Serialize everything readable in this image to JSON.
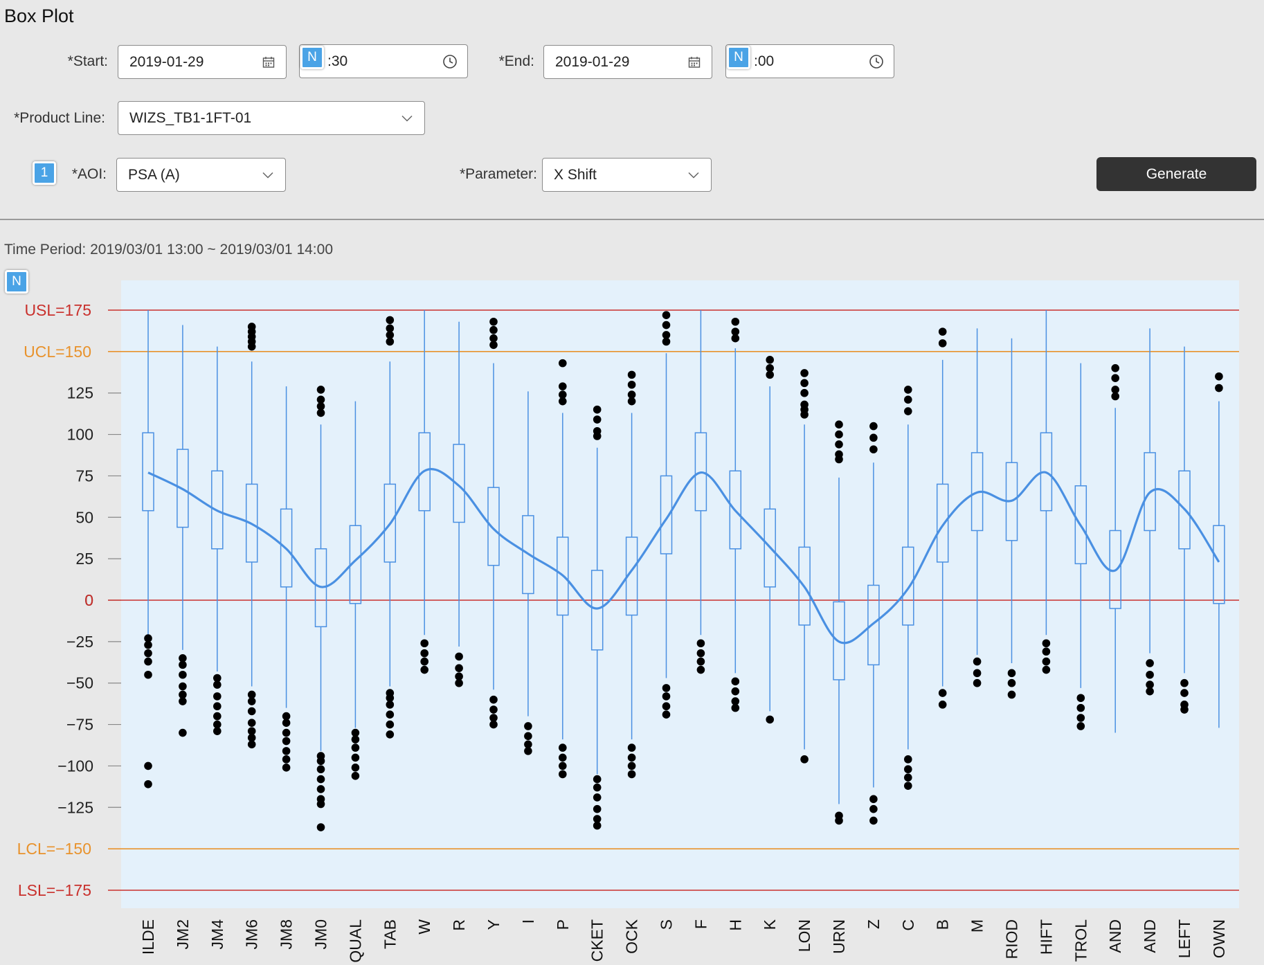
{
  "page": {
    "title": "Box Plot"
  },
  "filters": {
    "start_label": "*Start:",
    "start_date": "2019-01-29",
    "start_time": ":30",
    "end_label": "*End:",
    "end_date": "2019-01-29",
    "end_time": ":00",
    "product_line_label": "*Product Line:",
    "product_line_value": "WIZS_TB1-1FT-01",
    "aoi_label": "*AOI:",
    "aoi_value": "PSA (A)",
    "parameter_label": "*Parameter:",
    "parameter_value": "X Shift",
    "generate_label": "Generate"
  },
  "badges": {
    "start_time": "N",
    "end_time": "N",
    "aoi": "1",
    "chart": "N"
  },
  "time_period": "Time Period: 2019/03/01 13:00 ~ 2019/03/01 14:00",
  "icons": {
    "date": "calendar-icon",
    "time": "clock-icon",
    "select": "chevron-down-icon"
  },
  "colors": {
    "accent": "#4a90e2",
    "spec_limit": "#c9302c",
    "control_limit": "#e8922c",
    "zero_line": "#c9302c",
    "plot_bg": "#e4f1fb",
    "button": "#333333",
    "badge": "#4aa3e6"
  },
  "chart_data": {
    "type": "box",
    "ylim": [
      -185,
      185
    ],
    "yticks": [
      125,
      100,
      75,
      50,
      25,
      0,
      -25,
      -50,
      -75,
      -100,
      -125
    ],
    "ytick_labels": [
      "125",
      "100",
      "75",
      "50",
      "25",
      "0",
      "−25",
      "−50",
      "−75",
      "−100",
      "−125"
    ],
    "reference_lines": [
      {
        "label": "USL=175",
        "value": 175,
        "kind": "spec"
      },
      {
        "label": "UCL=150",
        "value": 150,
        "kind": "control"
      },
      {
        "label": "0",
        "value": 0,
        "kind": "zero"
      },
      {
        "label": "LCL=−150",
        "value": -150,
        "kind": "control"
      },
      {
        "label": "LSL=−175",
        "value": -175,
        "kind": "spec"
      }
    ],
    "categories": [
      "ILDE",
      "JM2",
      "JM4",
      "JM6",
      "JM8",
      "JM0",
      "QUAL",
      "TAB",
      "W",
      "R",
      "Y",
      "I",
      "P",
      "CKET",
      "OCK",
      "S",
      "F",
      "H",
      "K",
      "LON",
      "URN",
      "Z",
      "C",
      "B",
      "M",
      "RIOD",
      "HIFT",
      "TROL",
      "AND",
      "AND",
      "LEFT",
      "OWN"
    ],
    "boxes": [
      {
        "min": -22,
        "q1": 54,
        "q3": 101,
        "max": 175,
        "outliers": [
          -23,
          -27,
          -32,
          -37,
          -45,
          -100,
          -111
        ]
      },
      {
        "min": -30,
        "q1": 44,
        "q3": 91,
        "max": 166,
        "outliers": [
          -35,
          -39,
          -45,
          -52,
          -57,
          -61,
          -80
        ]
      },
      {
        "min": -43,
        "q1": 31,
        "q3": 78,
        "max": 153,
        "outliers": [
          -47,
          -51,
          -58,
          -64,
          -70,
          -75,
          -79
        ]
      },
      {
        "min": -52,
        "q1": 23,
        "q3": 70,
        "max": 144,
        "outliers": [
          -57,
          -61,
          -67,
          -74,
          -79,
          -83,
          -87,
          165,
          162,
          159,
          156,
          153
        ]
      },
      {
        "min": -65,
        "q1": 8,
        "q3": 55,
        "max": 129,
        "outliers": [
          -70,
          -74,
          -80,
          -85,
          -91,
          -96,
          -101
        ]
      },
      {
        "min": -91,
        "q1": -16,
        "q3": 31,
        "max": 106,
        "outliers": [
          -94,
          -97,
          -102,
          -108,
          -114,
          -120,
          -123,
          -137,
          127,
          121,
          117,
          113
        ]
      },
      {
        "min": -77,
        "q1": -2,
        "q3": 45,
        "max": 120,
        "outliers": [
          -80,
          -84,
          -89,
          -95,
          -101,
          -106
        ]
      },
      {
        "min": -52,
        "q1": 23,
        "q3": 70,
        "max": 144,
        "outliers": [
          -56,
          -59,
          -63,
          -69,
          -75,
          -81,
          169,
          164,
          160,
          156
        ]
      },
      {
        "min": -21,
        "q1": 54,
        "q3": 101,
        "max": 175,
        "outliers": [
          -26,
          -32,
          -37,
          -42
        ]
      },
      {
        "min": -28,
        "q1": 47,
        "q3": 94,
        "max": 168,
        "outliers": [
          -34,
          -41,
          -46,
          -50
        ]
      },
      {
        "min": -54,
        "q1": 21,
        "q3": 68,
        "max": 143,
        "outliers": [
          -60,
          -66,
          -71,
          -75,
          168,
          163,
          158,
          154
        ]
      },
      {
        "min": -70,
        "q1": 4,
        "q3": 51,
        "max": 126,
        "outliers": [
          -76,
          -82,
          -87,
          -91
        ]
      },
      {
        "min": -84,
        "q1": -9,
        "q3": 38,
        "max": 113,
        "outliers": [
          -89,
          -95,
          -100,
          -105,
          143,
          129,
          124,
          120
        ]
      },
      {
        "min": -105,
        "q1": -30,
        "q3": 18,
        "max": 92,
        "outliers": [
          -108,
          -113,
          -119,
          -126,
          -132,
          -136,
          115,
          109,
          102,
          99
        ]
      },
      {
        "min": -84,
        "q1": -9,
        "q3": 38,
        "max": 113,
        "outliers": [
          -89,
          -95,
          -100,
          -105,
          136,
          130,
          124,
          120
        ]
      },
      {
        "min": -47,
        "q1": 28,
        "q3": 75,
        "max": 149,
        "outliers": [
          -53,
          -58,
          -64,
          -69,
          172,
          166,
          160,
          156
        ]
      },
      {
        "min": -21,
        "q1": 54,
        "q3": 101,
        "max": 175,
        "outliers": [
          -26,
          -32,
          -37,
          -42
        ]
      },
      {
        "min": -44,
        "q1": 31,
        "q3": 78,
        "max": 152,
        "outliers": [
          -49,
          -55,
          -61,
          -65,
          168,
          162,
          158
        ]
      },
      {
        "min": -67,
        "q1": 8,
        "q3": 55,
        "max": 129,
        "outliers": [
          -72,
          145,
          140,
          136
        ]
      },
      {
        "min": -90,
        "q1": -15,
        "q3": 32,
        "max": 106,
        "outliers": [
          -96,
          137,
          131,
          125,
          118,
          115,
          112
        ]
      },
      {
        "min": -123,
        "q1": -48,
        "q3": -1,
        "max": 74,
        "outliers": [
          -130,
          -133,
          106,
          100,
          94,
          88,
          85
        ]
      },
      {
        "min": -113,
        "q1": -39,
        "q3": 9,
        "max": 83,
        "outliers": [
          -120,
          -126,
          -133,
          105,
          98,
          91
        ]
      },
      {
        "min": -90,
        "q1": -15,
        "q3": 32,
        "max": 106,
        "outliers": [
          -96,
          -102,
          -107,
          -112,
          127,
          121,
          114
        ]
      },
      {
        "min": -52,
        "q1": 23,
        "q3": 70,
        "max": 145,
        "outliers": [
          -56,
          -63,
          162,
          155
        ]
      },
      {
        "min": -33,
        "q1": 42,
        "q3": 89,
        "max": 164,
        "outliers": [
          -37,
          -44,
          -50
        ]
      },
      {
        "min": -38,
        "q1": 36,
        "q3": 83,
        "max": 158,
        "outliers": [
          -44,
          -50,
          -57
        ]
      },
      {
        "min": -21,
        "q1": 54,
        "q3": 101,
        "max": 175,
        "outliers": [
          -26,
          -31,
          -37,
          -42
        ]
      },
      {
        "min": -53,
        "q1": 22,
        "q3": 69,
        "max": 143,
        "outliers": [
          -59,
          -65,
          -71,
          -76
        ]
      },
      {
        "min": -80,
        "q1": -5,
        "q3": 42,
        "max": 116,
        "outliers": [
          140,
          134,
          127,
          123
        ]
      },
      {
        "min": -32,
        "q1": 42,
        "q3": 89,
        "max": 164,
        "outliers": [
          -38,
          -45,
          -51,
          -55
        ]
      },
      {
        "min": -44,
        "q1": 31,
        "q3": 78,
        "max": 153,
        "outliers": [
          -50,
          -56,
          -63,
          -66
        ]
      },
      {
        "min": -77,
        "q1": -2,
        "q3": 45,
        "max": 120,
        "outliers": [
          135,
          128
        ]
      }
    ],
    "trend": [
      77,
      67,
      54,
      46,
      31,
      8,
      24,
      46,
      78,
      69,
      43,
      28,
      15,
      -5,
      18,
      49,
      77,
      54,
      32,
      8,
      -25,
      -14,
      7,
      45,
      65,
      60,
      77,
      45,
      18,
      65,
      55,
      23
    ]
  }
}
